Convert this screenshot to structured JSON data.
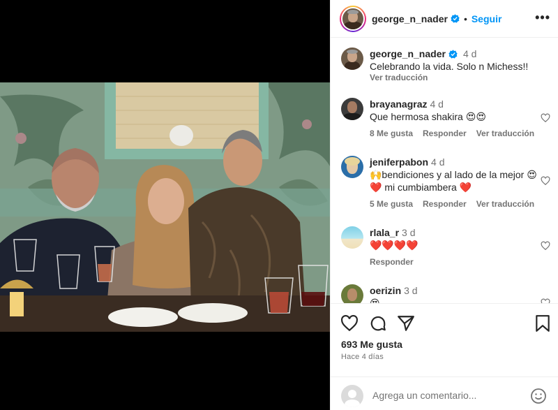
{
  "post": {
    "username": "george_n_nader",
    "follow_label": "Seguir",
    "dot": "•",
    "more_label": "•••",
    "caption_text": "Celebrando la vida. Solo n Michess!!",
    "caption_time": "4 d",
    "caption_translate": "Ver traducción"
  },
  "comments": [
    {
      "user": "brayanagraz",
      "time": "4 d",
      "text": "Que hermosa shakira 😍😍",
      "likes": "8 Me gusta",
      "reply": "Responder",
      "translate": "Ver traducción"
    },
    {
      "user": "jeniferpabon",
      "time": "4 d",
      "text": "🙌bendiciones y al lado de la mejor 😍❤️ mi cumbiambera ❤️",
      "likes": "5 Me gusta",
      "reply": "Responder",
      "translate": "Ver traducción"
    },
    {
      "user": "rlala_r",
      "time": "3 d",
      "text": "❤️❤️❤️❤️",
      "reply": "Responder"
    },
    {
      "user": "oerizin",
      "time": "3 d",
      "text": "😍"
    }
  ],
  "footer": {
    "likes_count": "693 Me gusta",
    "time_ago": "Hace 4 días",
    "comment_placeholder": "Agrega un comentario..."
  },
  "icons": [
    "verified-badge-icon",
    "heart-icon",
    "comment-icon",
    "share-icon",
    "bookmark-icon",
    "emoji-icon"
  ],
  "colors": {
    "accent": "#0095f6",
    "text": "#262626",
    "muted": "#737373",
    "border": "#efefef"
  }
}
